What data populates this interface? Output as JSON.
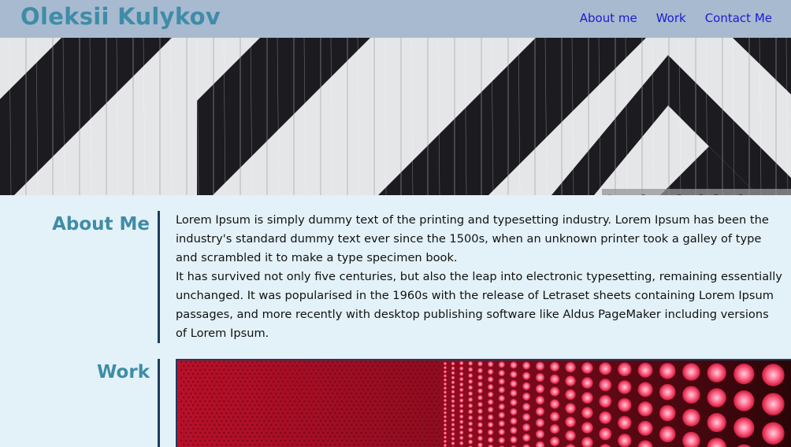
{
  "header": {
    "brand": "Oleksii Kulykov",
    "nav": [
      "About me",
      "Work",
      "Contact Me"
    ]
  },
  "hero": {
    "subtitle": "Cool subtitle here!"
  },
  "about": {
    "title": "About Me",
    "paragraphs": [
      "Lorem Ipsum is simply dummy text of the printing and typesetting industry. Lorem Ipsum has been the industry's standard dummy text ever since the 1500s, when an unknown printer took a galley of type and scrambled it to make a type specimen book.",
      "It has survived not only five centuries, but also the leap into electronic typesetting, remaining essentially unchanged. It was popularised in the 1960s with the release of Letraset sheets containing Lorem Ipsum passages, and more recently with desktop publishing software like Aldus PageMaker including versions of Lorem Ipsum."
    ]
  },
  "work": {
    "title": "Work"
  },
  "colors": {
    "header_bg": "#a8bacf",
    "brand": "#3f8ca8",
    "nav_link": "#1a1ad6",
    "page_bg": "#e3f2f8",
    "rule": "#1e3a5f"
  }
}
